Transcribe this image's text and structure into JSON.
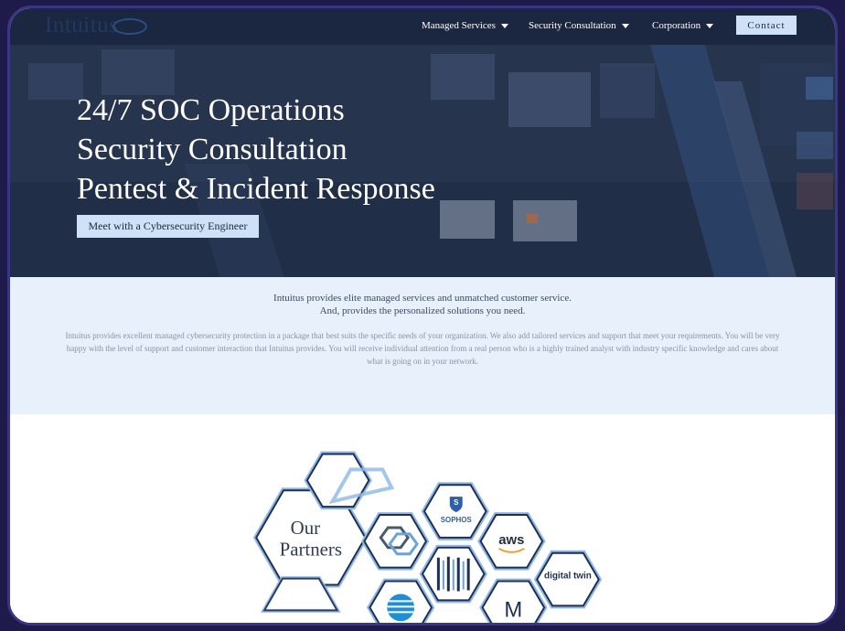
{
  "nav": {
    "logo": "Intuitus",
    "items": [
      {
        "label": "Managed Services"
      },
      {
        "label": "Security Consultation"
      },
      {
        "label": "Corporation"
      }
    ],
    "contact_label": "Contact"
  },
  "hero": {
    "lines": [
      "24/7 SOC Operations",
      "Security Consultation",
      "Pentest & Incident Response"
    ],
    "cta_label": "Meet with a Cybersecurity Engineer"
  },
  "intro": {
    "lead_1": "Intuitus provides elite managed services and unmatched customer service.",
    "lead_2": "And, provides the personalized solutions you need.",
    "body": "Intuitus provides excellent managed cybersecurity protection in a package that best suits the specific needs of your organization. We also add tailored services and support that meet your requirements. You will be very happy with the level of support and customer interaction that Intuitus provides. You will receive individual attention from a real person who is a highly trained analyst with industry specific knowledge and cares about what is going on in your network."
  },
  "partners": {
    "title_1": "Our",
    "title_2": "Partners",
    "logos": [
      "SOPHOS",
      "aws",
      "digital twin",
      "M"
    ]
  },
  "colors": {
    "nav_bg": "#1b2740",
    "button_bg": "#cfe1f7",
    "intro_bg": "#e8f0fb",
    "hex_border": "#1f2f52",
    "hex_glow": "#8fb8e6"
  }
}
